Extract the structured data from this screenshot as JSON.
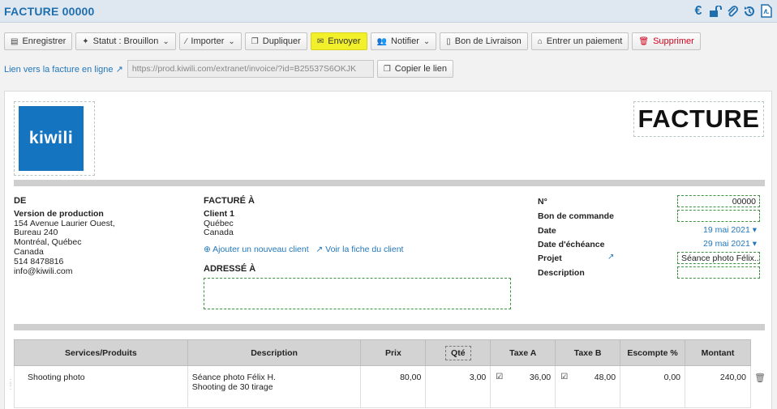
{
  "header": {
    "title": "FACTURE 00000"
  },
  "top_icons": [
    "euro-icon",
    "unlock-icon",
    "paperclip-icon",
    "history-icon",
    "pdf-icon"
  ],
  "toolbar": {
    "save": "Enregistrer",
    "status": "Statut : Brouillon",
    "import": "Importer",
    "duplicate": "Dupliquer",
    "send": "Envoyer",
    "notify": "Notifier",
    "delivery": "Bon de Livraison",
    "payment": "Entrer un paiement",
    "delete": "Supprimer"
  },
  "link_row": {
    "label": "Lien vers la facture en ligne",
    "url": "https://prod.kiwili.com/extranet/invoice/?id=B25537S6OKJK",
    "copy": "Copier le lien"
  },
  "invoice": {
    "logo_text": "kiwili",
    "doc_title": "FACTURE",
    "from": {
      "heading": "DE",
      "name": "Version de production",
      "lines": [
        "154 Avenue Laurier Ouest,",
        "Bureau 240",
        "Montréal, Québec",
        "Canada",
        "514 8478816",
        "info@kiwili.com"
      ]
    },
    "billed_to": {
      "heading": "FACTURÉ À",
      "name": "Client 1",
      "lines": [
        "Québec",
        "Canada"
      ],
      "add_client": "Ajouter un nouveau client",
      "view_client": "Voir la fiche du client"
    },
    "ship_to": {
      "heading": "ADRESSÉ À"
    },
    "meta": {
      "no_label": "N°",
      "no_value": "00000",
      "po_label": "Bon de commande",
      "po_value": "",
      "date_label": "Date",
      "date_value": "19 mai 2021",
      "due_label": "Date d'échéance",
      "due_value": "29 mai 2021",
      "project_label": "Projet",
      "project_value": "Séance photo Félix...",
      "desc_label": "Description",
      "desc_value": ""
    },
    "columns": [
      "Services/Produits",
      "Description",
      "Prix",
      "Qté",
      "Taxe A",
      "Taxe B",
      "Escompte %",
      "Montant"
    ],
    "rows": [
      {
        "product": "Shooting photo",
        "desc1": "Séance photo Félix H.",
        "desc2": "Shooting de 30 tirage",
        "price": "80,00",
        "qty": "3,00",
        "tax_a": "36,00",
        "tax_b": "48,00",
        "discount": "0,00",
        "amount": "240,00"
      }
    ]
  },
  "colors": {
    "brand": "#1f6fae",
    "highlight": "#f2ef2b",
    "danger": "#d0021b",
    "logo_bg": "#1474c0"
  }
}
